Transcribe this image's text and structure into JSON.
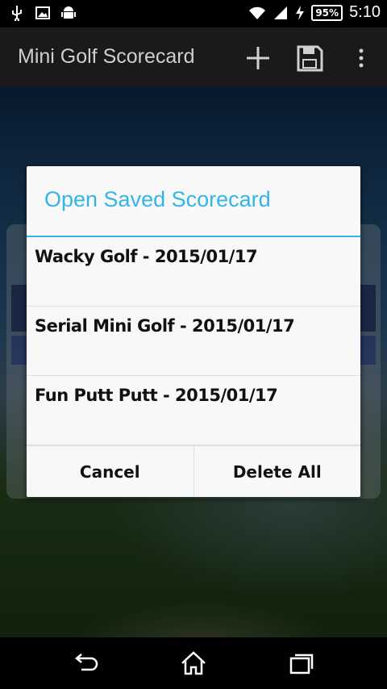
{
  "status_bar": {
    "battery": "95%",
    "time": "5:10",
    "icons": [
      "usb-icon",
      "image-icon",
      "android-icon",
      "wifi-icon",
      "signal-icon",
      "charging-icon"
    ]
  },
  "action_bar": {
    "title": "Mini Golf Scorecard",
    "icons": [
      "add-icon",
      "save-icon",
      "overflow-menu-icon"
    ]
  },
  "dialog": {
    "title": "Open Saved Scorecard",
    "accent_color": "#33b5e5",
    "items": [
      {
        "label": "Wacky Golf - 2015/01/17"
      },
      {
        "label": "Serial Mini Golf - 2015/01/17"
      },
      {
        "label": "Fun Putt Putt - 2015/01/17"
      }
    ],
    "buttons": {
      "cancel": "Cancel",
      "delete_all": "Delete All"
    }
  },
  "nav_bar": {
    "icons": [
      "back-icon",
      "home-icon",
      "recent-apps-icon"
    ]
  }
}
